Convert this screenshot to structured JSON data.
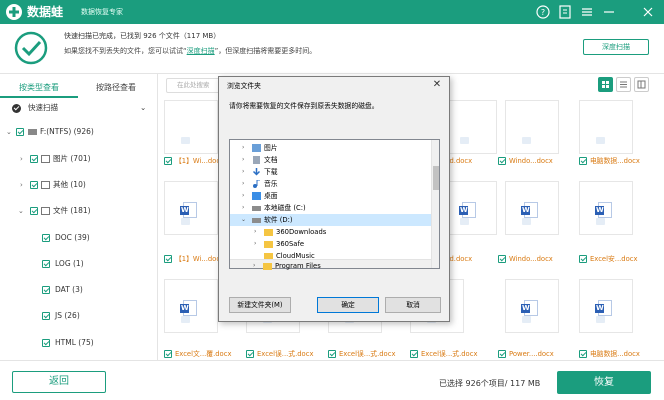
{
  "app": {
    "name": "数据蛙",
    "subtitle": "数据恢复专家"
  },
  "summary": {
    "line1": "快速扫描已完成，已找到 926 个文件（117 MB）",
    "line2_pre": "如果您找不到丢失的文件，您可以试试“",
    "line2_link": "深度扫描",
    "line2_post": "”，但深度扫描将需要更多时间。",
    "deep_scan_button": "深度扫描"
  },
  "tabs": [
    {
      "label": "按类型查看"
    },
    {
      "label": "按路径查看"
    }
  ],
  "search": {
    "placeholder": "在此处搜索"
  },
  "sidebar": {
    "quick_scan": "快速扫描",
    "drive": "F:(NTFS) (926)",
    "items": [
      {
        "label": "图片 (701)"
      },
      {
        "label": "其他 (10)"
      },
      {
        "label": "文件 (181)"
      },
      {
        "label": "DOC (39)"
      },
      {
        "label": "LOG (1)"
      },
      {
        "label": "DAT (3)"
      },
      {
        "label": "JS (26)"
      },
      {
        "label": "HTML (75)"
      }
    ]
  },
  "files": {
    "row1": [
      "【1】Wi...docx",
      "...d.docx",
      "Windo...docx",
      "电脑数据...docx"
    ],
    "row2": [
      "【1】Wi...docx",
      "...d.docx",
      "Windo...docx",
      "Excel安...docx"
    ],
    "row3": [
      "Excel文...覆.docx",
      "Excel误...式.docx",
      "Excel误...式.docx",
      "Excel误...式.docx",
      "Power....docx",
      "电脑数据...docx"
    ]
  },
  "dialog": {
    "title": "浏览文件夹",
    "close": "✕",
    "prompt": "请你将需要恢复的文件保存到原丢失数据的磁盘。",
    "tree": [
      {
        "label": "图片"
      },
      {
        "label": "文档"
      },
      {
        "label": "下载"
      },
      {
        "label": "音乐"
      },
      {
        "label": "桌面"
      },
      {
        "label": "本地磁盘 (C:)"
      },
      {
        "label": "软件 (D:)"
      },
      {
        "label": "360Downloads"
      },
      {
        "label": "360Safe"
      },
      {
        "label": "CloudMusic"
      },
      {
        "label": "Program Files"
      }
    ],
    "new_folder": "新建文件夹(M)",
    "ok": "确定",
    "cancel": "取消"
  },
  "footer": {
    "back": "返回",
    "selection": "已选择 926个项目/ 117 MB",
    "recover": "恢复"
  },
  "colors": {
    "accent": "#1b9d7e",
    "file_label": "#d97a12",
    "word_blue": "#2b5fb4"
  }
}
